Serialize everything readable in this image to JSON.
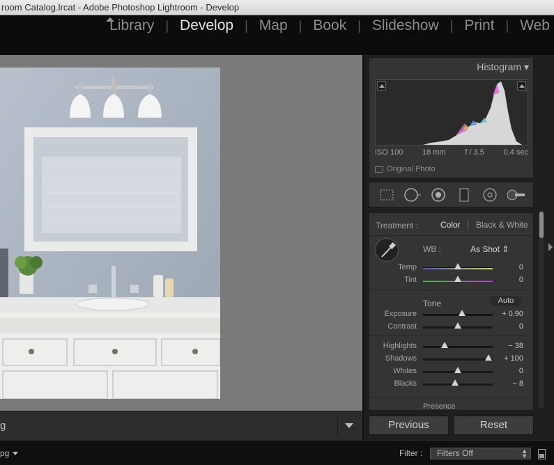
{
  "window": {
    "title": "room Catalog.lrcat - Adobe Photoshop Lightroom - Develop"
  },
  "modules": [
    {
      "label": "Library",
      "active": false
    },
    {
      "label": "Develop",
      "active": true
    },
    {
      "label": "Map",
      "active": false
    },
    {
      "label": "Book",
      "active": false
    },
    {
      "label": "Slideshow",
      "active": false
    },
    {
      "label": "Print",
      "active": false
    },
    {
      "label": "Web",
      "active": false
    }
  ],
  "toolbar": {
    "label": "g"
  },
  "histogram": {
    "title": "Histogram",
    "iso": "ISO 100",
    "focal": "18 mm",
    "aperture": "f / 3.5",
    "shutter": "0.4 sec",
    "original_photo": "Original Photo"
  },
  "tools": [
    "crop-overlay",
    "spot-removal",
    "red-eye",
    "graduated-filter",
    "radial-filter",
    "adjustment-brush"
  ],
  "basic": {
    "treatment_label": "Treatment :",
    "treatment_color": "Color",
    "treatment_bw": "Black & White",
    "wb_label": "WB :",
    "wb_value": "As Shot",
    "tone_title": "Tone",
    "auto_label": "Auto",
    "presence_title": "Presence",
    "sliders": {
      "temp": {
        "label": "Temp",
        "value": "0",
        "pos": 0.5
      },
      "tint": {
        "label": "Tint",
        "value": "0",
        "pos": 0.5
      },
      "exposure": {
        "label": "Exposure",
        "value": "+ 0.90",
        "pos": 0.56
      },
      "contrast": {
        "label": "Contrast",
        "value": "0",
        "pos": 0.5
      },
      "highlights": {
        "label": "Highlights",
        "value": "− 38",
        "pos": 0.31
      },
      "shadows": {
        "label": "Shadows",
        "value": "+ 100",
        "pos": 0.94
      },
      "whites": {
        "label": "Whites",
        "value": "0",
        "pos": 0.5
      },
      "blacks": {
        "label": "Blacks",
        "value": "− 8",
        "pos": 0.46
      }
    }
  },
  "buttons": {
    "previous": "Previous",
    "reset": "Reset"
  },
  "filterbar": {
    "left_label": "pg",
    "filter_label": "Filter :",
    "filter_value": "Filters Off"
  }
}
